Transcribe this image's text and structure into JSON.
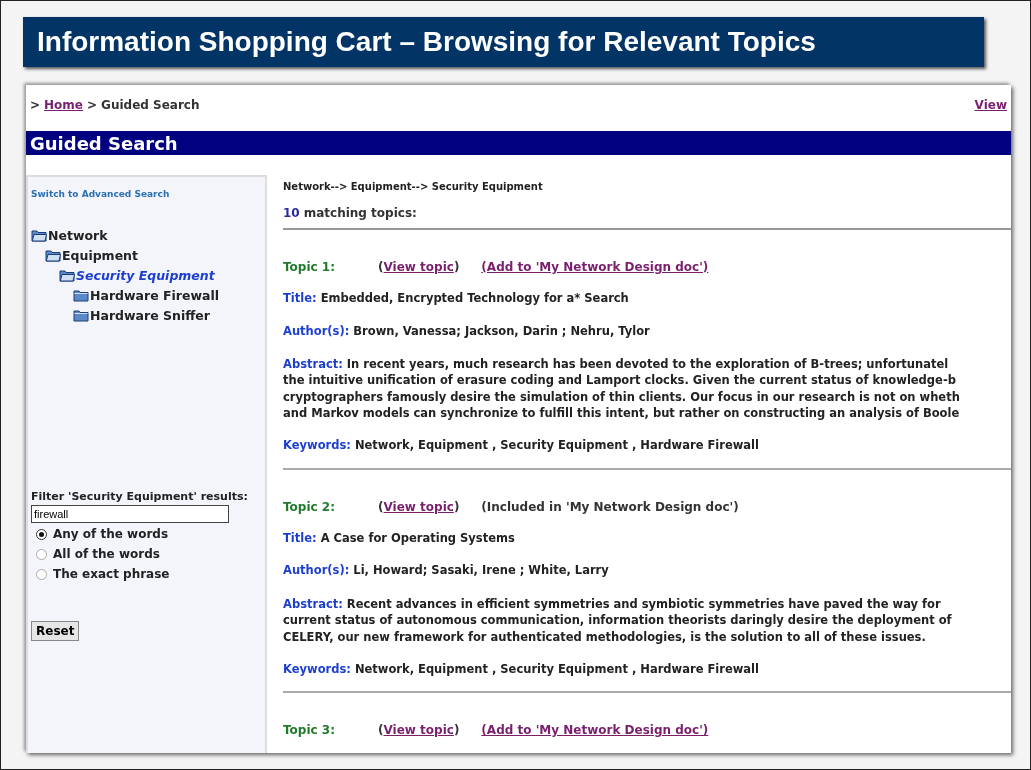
{
  "slide_title": "Information Shopping Cart – Browsing for Relevant Topics",
  "breadcrumb": {
    "sep1": ">",
    "home": "Home",
    "sep2": ">",
    "current": "Guided Search",
    "right_link": "View"
  },
  "section_header": "Guided Search",
  "sidebar": {
    "advanced_link": "Switch to Advanced Search",
    "tree": [
      {
        "label": "Network",
        "expanded": true,
        "selected": false,
        "children": [
          {
            "label": "Equipment",
            "expanded": true,
            "selected": false,
            "children": [
              {
                "label": "Security Equipment",
                "expanded": true,
                "selected": true,
                "children": [
                  {
                    "label": "Hardware Firewall",
                    "expanded": false,
                    "selected": false
                  },
                  {
                    "label": "Hardware Sniffer",
                    "expanded": false,
                    "selected": false
                  }
                ]
              }
            ]
          }
        ]
      }
    ],
    "filter": {
      "label": "Filter 'Security Equipment' results:",
      "value": "firewall",
      "options": [
        {
          "label": "Any of the words",
          "selected": true
        },
        {
          "label": "All of the words",
          "selected": false
        },
        {
          "label": "The exact phrase",
          "selected": false
        }
      ],
      "reset": "Reset"
    }
  },
  "path": "Network--> Equipment--> Security Equipment",
  "count": {
    "number": "10",
    "text": "matching topics:"
  },
  "topics": [
    {
      "label": "Topic 1:",
      "view_open": "(",
      "view_link": "View topic",
      "view_close": ")",
      "action": {
        "kind": "link",
        "text": "(Add to 'My Network Design doc')"
      },
      "fields": [
        {
          "label": "Title:",
          "lines": [
            "Embedded, Encrypted Technology for a* Search"
          ]
        },
        {
          "label": "Author(s):",
          "lines": [
            "Brown, Vanessa; Jackson, Darin ; Nehru, Tylor"
          ]
        },
        {
          "label": "Abstract:",
          "lines": [
            "In recent years, much research has been devoted to the exploration of B-trees; unfortunatel",
            "the intuitive unification of erasure coding and Lamport clocks. Given the current status of knowledge-b",
            "cryptographers famously desire the simulation of thin clients. Our focus in our research is not on wheth",
            "and Markov models can synchronize to fulfill this intent, but rather on constructing an analysis of Boole"
          ]
        },
        {
          "label": "Keywords:",
          "lines": [
            "Network, Equipment , Security Equipment , Hardware Firewall"
          ]
        }
      ]
    },
    {
      "label": "Topic 2:",
      "view_open": "(",
      "view_link": "View topic",
      "view_close": ")",
      "action": {
        "kind": "note",
        "text": "(Included in 'My Network Design doc')"
      },
      "fields": [
        {
          "label": "Title:",
          "lines": [
            "A Case for Operating Systems"
          ]
        },
        {
          "label": "Author(s):",
          "lines": [
            "Li, Howard; Sasaki, Irene ; White, Larry"
          ]
        },
        {
          "label": "Abstract:",
          "lines": [
            "Recent advances in efficient symmetries and symbiotic symmetries have paved the way for",
            "current status of autonomous communication, information theorists daringly desire the deployment of",
            "CELERY, our new framework for authenticated methodologies, is the solution to all of these issues."
          ]
        },
        {
          "label": "Keywords:",
          "lines": [
            "Network, Equipment , Security Equipment , Hardware Firewall"
          ]
        }
      ]
    },
    {
      "label": "Topic 3:",
      "view_open": "(",
      "view_link": "View topic",
      "view_close": ")",
      "action": {
        "kind": "link",
        "text": "(Add to 'My Network Design doc')"
      }
    }
  ]
}
